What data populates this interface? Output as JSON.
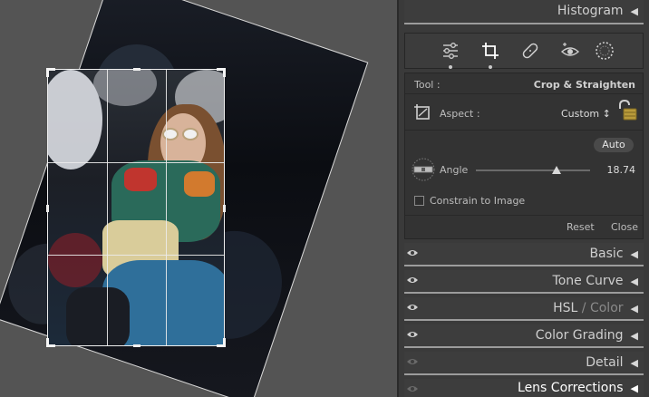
{
  "panel": {
    "histogram": {
      "title": "Histogram"
    },
    "crop": {
      "tool_label": "Tool :",
      "tool_name": "Crop & Straighten",
      "aspect_label": "Aspect :",
      "aspect_value": "Custom ↕",
      "auto_label": "Auto",
      "angle_label": "Angle",
      "angle_value": "18.74",
      "angle_slider": {
        "min": -45,
        "max": 45,
        "value": 18.74
      },
      "constrain_label": "Constrain to Image",
      "constrain_checked": false,
      "reset_label": "Reset",
      "close_label": "Close"
    },
    "sections": [
      {
        "title": "Basic"
      },
      {
        "title": "Tone Curve"
      },
      {
        "title_main": "HSL",
        "title_sep": " / ",
        "title_alt": "Color"
      },
      {
        "title": "Color Grading"
      },
      {
        "title": "Detail"
      },
      {
        "title": "Lens Corrections"
      }
    ]
  },
  "colors": {
    "accent": "#d8d8d8",
    "panel_bg": "#3a3a3a",
    "canvas_bg": "#545454"
  },
  "icons": [
    "edit-sliders-icon",
    "crop-icon",
    "healing-icon",
    "red-eye-icon",
    "masking-icon",
    "crop-frame-icon",
    "lock-open-icon",
    "level-icon",
    "eye-icon"
  ]
}
